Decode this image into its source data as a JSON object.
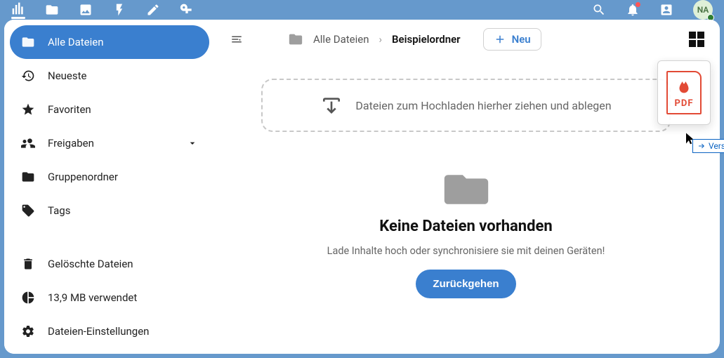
{
  "colors": {
    "brand": "#6699cc",
    "accent": "#3a7fcf",
    "danger": "#e03b24"
  },
  "topbar": {
    "icons": [
      "dashboard-icon",
      "files-icon",
      "photos-icon",
      "activity-icon",
      "edit-icon",
      "key-icon"
    ],
    "right_icons": [
      "search-icon",
      "notifications-icon",
      "contacts-icon"
    ],
    "avatar_initials": "NA"
  },
  "sidebar": {
    "items": [
      {
        "icon": "folder-icon",
        "label": "Alle Dateien",
        "active": true
      },
      {
        "icon": "history-icon",
        "label": "Neueste",
        "active": false
      },
      {
        "icon": "star-icon",
        "label": "Favoriten",
        "active": false
      },
      {
        "icon": "share-icon",
        "label": "Freigaben",
        "active": false,
        "expandable": true
      },
      {
        "icon": "group-icon",
        "label": "Gruppenordner",
        "active": false
      },
      {
        "icon": "tag-icon",
        "label": "Tags",
        "active": false
      },
      {
        "icon": "trash-icon",
        "label": "Gelöschte Dateien",
        "active": false
      },
      {
        "icon": "pie-icon",
        "label": "13,9 MB verwendet",
        "active": false
      },
      {
        "icon": "gear-icon",
        "label": "Dateien-Einstellungen",
        "active": false
      }
    ],
    "gap_after_index": 5
  },
  "breadcrumb": {
    "items": [
      "Alle Dateien",
      "Beispielordner"
    ],
    "current_index": 1
  },
  "new_button_label": "Neu",
  "dropzone_text": "Dateien zum Hochladen hierher ziehen und ablegen",
  "empty_state": {
    "title": "Keine Dateien vorhanden",
    "subtitle": "Lade Inhalte hoch oder synchronisiere sie mit deinen Geräten!",
    "back_label": "Zurückgehen"
  },
  "drag": {
    "file_type_label": "PDF",
    "tooltip_label": "Verschieben"
  }
}
